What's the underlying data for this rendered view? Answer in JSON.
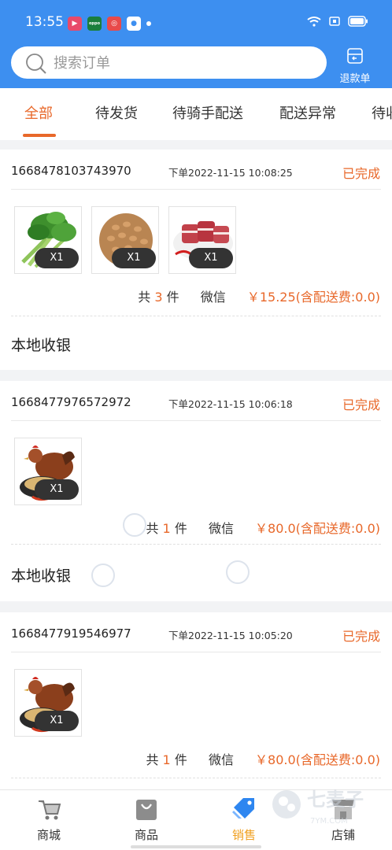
{
  "status_bar": {
    "time": "13:55",
    "app_icons": [
      "video-icon",
      "oppo-icon",
      "news-icon",
      "app-icon"
    ],
    "oppo_text": "oppo"
  },
  "header": {
    "search_placeholder": "搜索订单",
    "refund_label": "退款单",
    "colors": {
      "primary": "#3d8ff0",
      "accent": "#e8682a"
    }
  },
  "tabs": [
    {
      "label": "全部",
      "active": true
    },
    {
      "label": "待发货"
    },
    {
      "label": "待骑手配送"
    },
    {
      "label": "配送异常"
    },
    {
      "label": "待收"
    }
  ],
  "orders": [
    {
      "id": "1668478103743970",
      "time": "下单2022-11-15 10:08:25",
      "status": "已完成",
      "items": [
        {
          "image": "vegetable-image",
          "qty": "X1"
        },
        {
          "image": "peanut-image",
          "qty": "X1"
        },
        {
          "image": "pork-image",
          "qty": "X1"
        }
      ],
      "total_prefix": "共",
      "count": "3",
      "count_suffix": "件",
      "payment": "微信",
      "price": "￥15.25(含配送费:0.0)",
      "channel": "本地收银"
    },
    {
      "id": "1668477976572972",
      "time": "下单2022-11-15 10:06:18",
      "status": "已完成",
      "items": [
        {
          "image": "chicken-image",
          "qty": "X1"
        }
      ],
      "total_prefix": "共",
      "count": "1",
      "count_suffix": "件",
      "payment": "微信",
      "price": "￥80.0(含配送费:0.0)",
      "channel": "本地收银"
    },
    {
      "id": "1668477919546977",
      "time": "下单2022-11-15 10:05:20",
      "status": "已完成",
      "items": [
        {
          "image": "chicken-image",
          "qty": "X1"
        }
      ],
      "total_prefix": "共",
      "count": "1",
      "count_suffix": "件",
      "payment": "微信",
      "price": "￥80.0(含配送费:0.0)"
    }
  ],
  "bottom_nav": [
    {
      "label": "商城",
      "icon": "cart-icon"
    },
    {
      "label": "商品",
      "icon": "bag-icon"
    },
    {
      "label": "销售",
      "icon": "tag-icon",
      "active": true
    },
    {
      "label": "店铺",
      "icon": "store-icon"
    }
  ],
  "watermark": {
    "text": "七麦子",
    "sub": "7YM.COM"
  }
}
